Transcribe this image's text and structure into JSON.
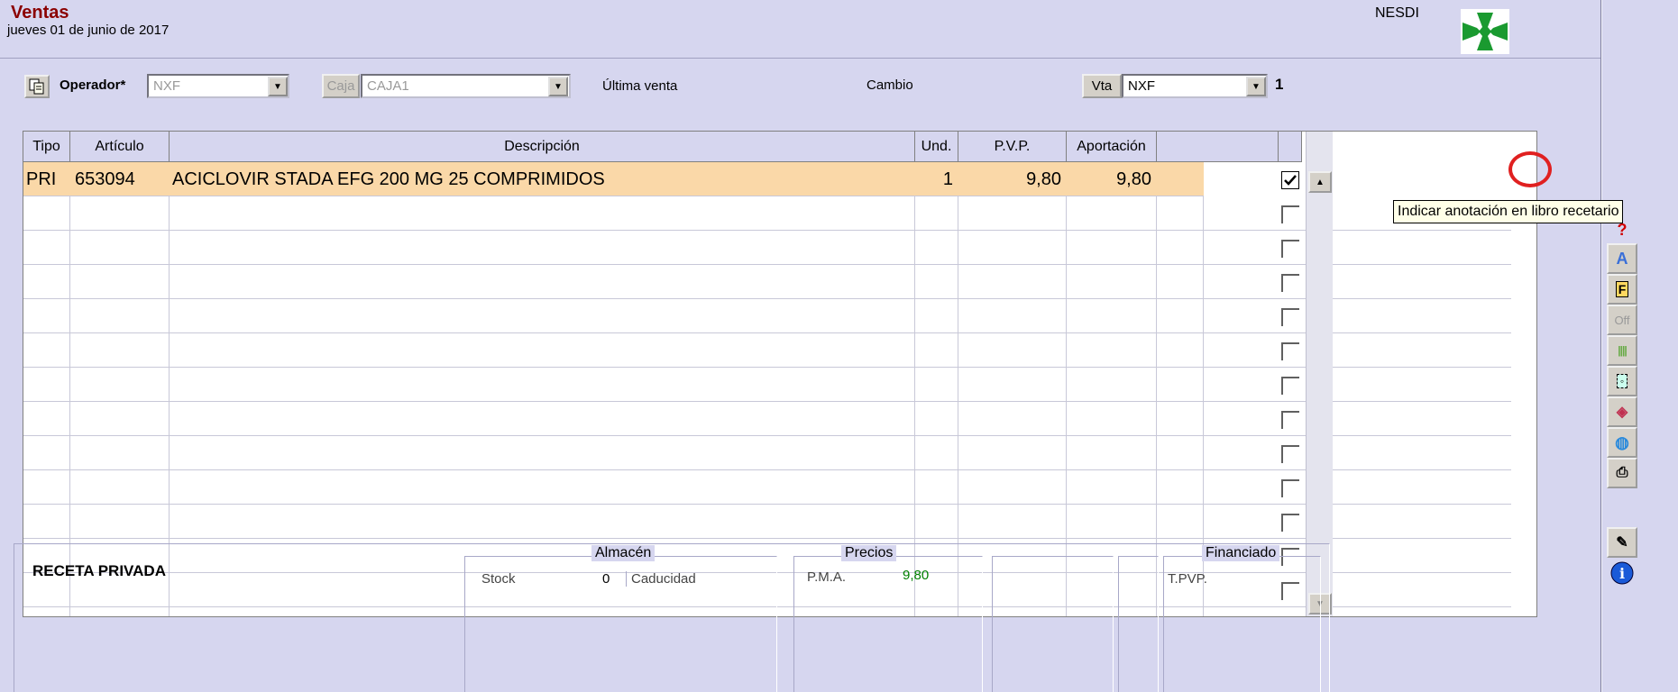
{
  "header": {
    "title": "Ventas",
    "date": "jueves 01 de junio de 2017",
    "user": "NESDI"
  },
  "toolbar": {
    "operador_label": "Operador*",
    "operador_value": "NXF",
    "caja_label": "Caja",
    "caja_value": "CAJA1",
    "ultima_venta_label": "Última venta",
    "cambio_label": "Cambio",
    "vta_label": "Vta",
    "vta_value": "NXF",
    "vta_count": "1"
  },
  "grid": {
    "columns": [
      "Tipo",
      "Artículo",
      "Descripción",
      "Und.",
      "P.V.P.",
      "Aportación",
      "",
      ""
    ],
    "rows": [
      {
        "tipo": "PRI",
        "articulo": "653094",
        "descripcion": "ACICLOVIR STADA EFG 200 MG 25 COMPRIMIDOS",
        "und": "1",
        "pvp": "9,80",
        "aportacion": "9,80",
        "checked": true
      }
    ]
  },
  "tooltip": "Indicar anotación en libro recetario",
  "sidebar_icons": [
    "question-icon",
    "font-icon",
    "f-icon",
    "off-icon",
    "barcode-icon",
    "card-icon",
    "pill-icon",
    "globe-icon",
    "printer-icon",
    "tools-icon",
    "info-icon"
  ],
  "bottom": {
    "receta": "RECETA PRIVADA",
    "almacen_title": "Almacén",
    "stock_label": "Stock",
    "stock_value": "0",
    "caducidad_label": "Caducidad",
    "precios_title": "Precios",
    "pma_label": "P.M.A.",
    "pma_value": "9,80",
    "financiado_title": "Financiado",
    "tpvp_label": "T.PVP."
  },
  "colors": {
    "title": "#8b0000",
    "selected_row": "#fad8a8",
    "highlight_ring": "#e02020",
    "pma_value": "#008000"
  }
}
